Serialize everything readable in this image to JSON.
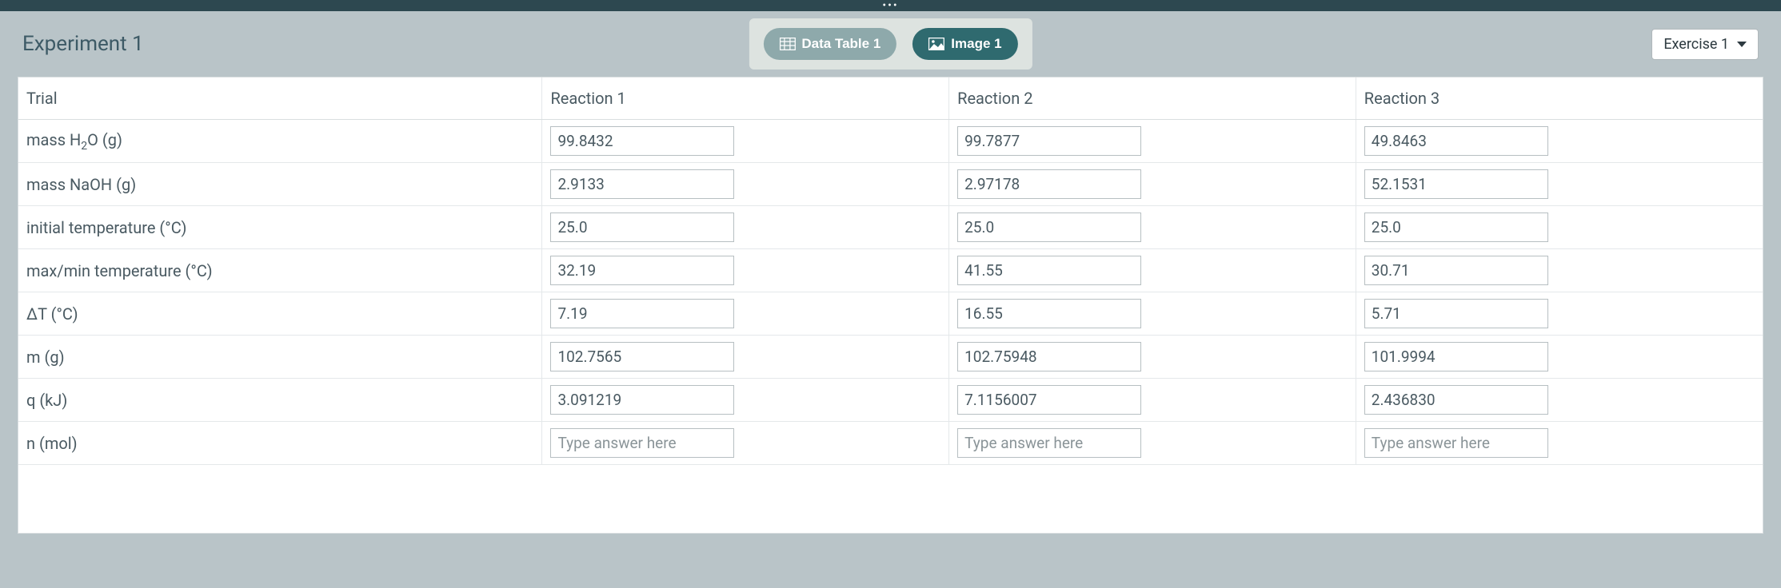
{
  "header": {
    "title": "Experiment 1",
    "tabs": [
      {
        "label": "Data Table 1"
      },
      {
        "label": "Image 1"
      }
    ],
    "exercise_dropdown": "Exercise 1"
  },
  "table": {
    "columns": [
      "Trial",
      "Reaction 1",
      "Reaction 2",
      "Reaction 3"
    ],
    "rows": [
      {
        "label_html": "mass H<sub>2</sub>O (g)",
        "r1": "99.8432",
        "r2": "99.7877",
        "r3": "49.8463"
      },
      {
        "label_html": "mass NaOH (g)",
        "r1": "2.9133",
        "r2": "2.97178",
        "r3": "52.1531"
      },
      {
        "label_html": "initial temperature (°C)",
        "r1": "25.0",
        "r2": "25.0",
        "r3": "25.0"
      },
      {
        "label_html": "max/min temperature (°C)",
        "r1": "32.19",
        "r2": "41.55",
        "r3": "30.71"
      },
      {
        "label_html": "ΔT (°C)",
        "r1": "7.19",
        "r2": "16.55",
        "r3": "5.71"
      },
      {
        "label_html": "m (g)",
        "r1": "102.7565",
        "r2": "102.75948",
        "r3": "101.9994"
      },
      {
        "label_html": "q (kJ)",
        "r1": "3.091219",
        "r2": "7.1156007",
        "r3": "2.436830"
      },
      {
        "label_html": "n (mol)",
        "r1": "",
        "r2": "",
        "r3": ""
      }
    ],
    "placeholder": "Type answer here"
  }
}
